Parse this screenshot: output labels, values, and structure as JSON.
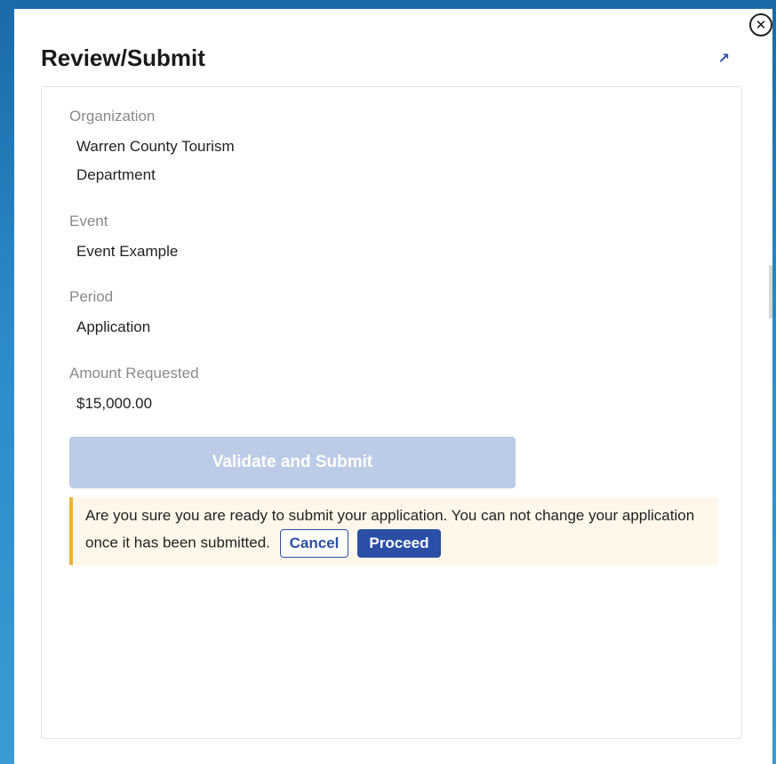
{
  "window": {
    "close_icon": "close-icon",
    "expand_icon": "expand-arrow-icon"
  },
  "header": {
    "title": "Review/Submit"
  },
  "review": {
    "fields": [
      {
        "label": "Organization",
        "value": "Warren County Tourism Department"
      },
      {
        "label": "Event",
        "value": "Event Example"
      },
      {
        "label": "Period",
        "value": "Application"
      },
      {
        "label": "Amount Requested",
        "value": "$15,000.00"
      }
    ],
    "validate_label": "Validate and Submit"
  },
  "confirm": {
    "message": "Are you sure you are ready to submit your application. You can not change your application once it has been submitted.",
    "cancel_label": "Cancel",
    "proceed_label": "Proceed"
  },
  "colors": {
    "primary": "#2b4fa6",
    "disabled_button": "#bccbe6",
    "warning_border": "#f0b232",
    "warning_bg": "#fff8ea"
  }
}
